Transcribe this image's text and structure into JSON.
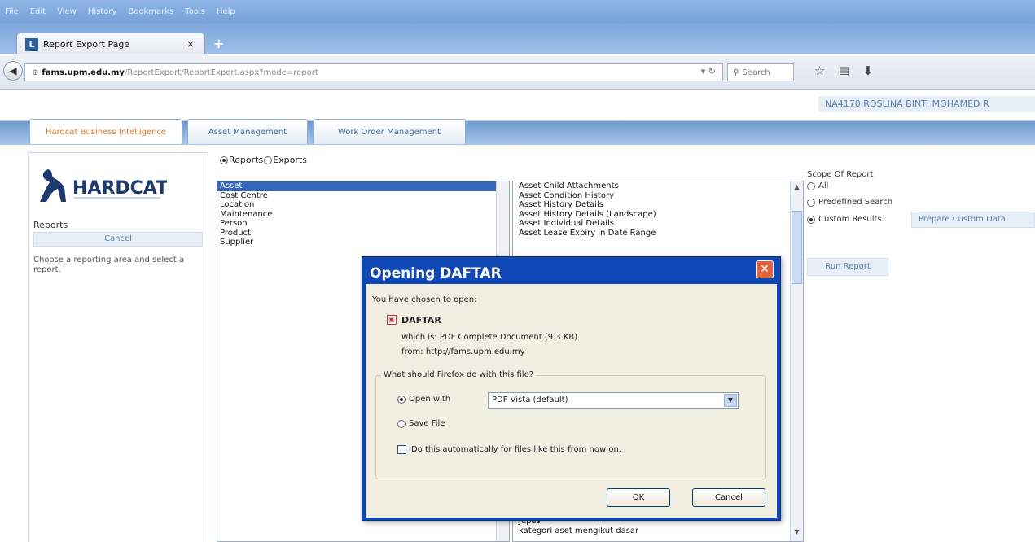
{
  "menubar": [
    "File",
    "Edit",
    "View",
    "History",
    "Bookmarks",
    "Tools",
    "Help"
  ],
  "browser_tab": {
    "title": "Report Export Page",
    "close": "×",
    "new_tab": "+"
  },
  "nav": {
    "url_host": "fams.upm.edu.my",
    "url_path": "/ReportExport/ReportExport.aspx?mode=report",
    "url_prefix": "",
    "search_placeholder": "Search"
  },
  "user_name": "NA4170 ROSLINA BINTI MOHAMED R",
  "app_tabs": [
    "Hardcat Business Intelligence",
    "Asset Management",
    "Work Order Management"
  ],
  "left_panel": {
    "logo_text": "HARDCAT",
    "reports_label": "Reports",
    "cancel": "Cancel",
    "help": "Choose a reporting area and select a report."
  },
  "mode": {
    "reports": "Reports",
    "exports": "Exports"
  },
  "areas": [
    "Asset",
    "Cost Centre",
    "Location",
    "Maintenance",
    "Person",
    "Product",
    "Supplier"
  ],
  "reports": [
    "Asset Child Attachments",
    "Asset Condition History",
    "Asset History Details",
    "Asset History Details (Landscape)",
    "Asset Individual Details",
    "Asset Lease Expiry in Date Range"
  ],
  "reports_bottom": [
    "Jepas",
    "kategori aset mengikut dasar"
  ],
  "scope": {
    "title": "Scope Of Report",
    "all": "All",
    "predefined": "Predefined Search",
    "custom": "Custom Results",
    "prepare": "Prepare Custom Data",
    "run": "Run Report"
  },
  "dialog": {
    "title": "Opening DAFTAR",
    "chosen": "You have chosen to open:",
    "filename": "DAFTAR",
    "which": "which is: PDF Complete Document (9.3 KB)",
    "from": "from: http://fams.upm.edu.my",
    "question": "What should Firefox do with this file?",
    "open_with_label": "Open with",
    "open_with_value": "PDF Vista (default)",
    "save_file": "Save File",
    "auto": "Do this automatically for files like this from now on.",
    "ok": "OK",
    "cancel": "Cancel"
  }
}
